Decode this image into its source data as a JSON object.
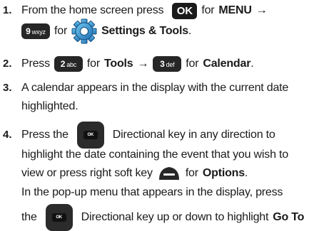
{
  "steps": [
    {
      "number": "1.",
      "l1": {
        "a": "From the home screen press",
        "b": "for",
        "c": "MENU",
        "arrow": "→"
      },
      "l2": {
        "a": "for",
        "b": "Settings & Tools",
        "c": "."
      },
      "keys": {
        "ok": "OK",
        "menu_digit": "9",
        "menu_letters": "wxyz"
      }
    },
    {
      "number": "2.",
      "l1": {
        "a": "Press",
        "b": "for",
        "c": "Tools",
        "arrow": "→",
        "d": "for",
        "e": "Calendar",
        "f": "."
      },
      "keys": {
        "k1_digit": "2",
        "k1_letters": "abc",
        "k2_digit": "3",
        "k2_letters": "def"
      }
    },
    {
      "number": "3.",
      "l1": "A calendar appears in the display with the current date",
      "l2": "highlighted."
    },
    {
      "number": "4.",
      "l1": {
        "a": "Press the",
        "b": "Directional key in any direction to"
      },
      "l2": "highlight the date containing the event that you wish to",
      "l3": {
        "a": "view or press right soft key",
        "b": "for",
        "c": "Options",
        "d": "."
      },
      "l4": "In the pop-up menu that appears in the display, press",
      "l5": {
        "a": "the",
        "b": "Directional key up or down to highlight",
        "c": "Go To"
      },
      "keys": {
        "dir": "OK"
      }
    }
  ]
}
